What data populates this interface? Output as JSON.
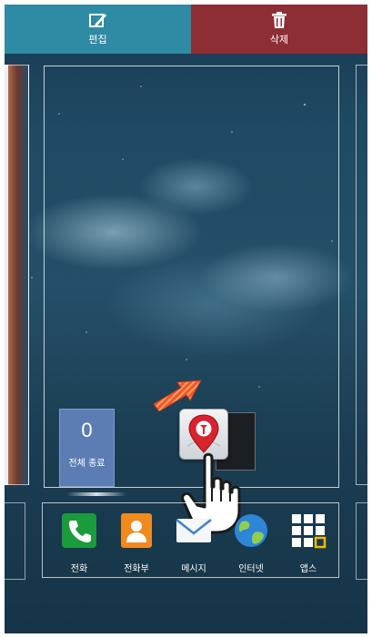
{
  "top_bar": {
    "edit_label": "편집",
    "delete_label": "삭제",
    "edit_color": "#2f8aa3",
    "delete_color": "#8d2d34",
    "edit_icon": "edit-icon",
    "delete_icon": "trash-icon"
  },
  "widget": {
    "count": "0",
    "label": "전체 종료",
    "color": "#5b7db3"
  },
  "dragged_app": {
    "icon": "map-pin-app-icon"
  },
  "dock": {
    "items": [
      {
        "label": "전화",
        "icon": "phone-icon",
        "color": "#1a9b3c"
      },
      {
        "label": "전화부",
        "icon": "contacts-icon",
        "color": "#f08a1c"
      },
      {
        "label": "메시지",
        "icon": "message-icon",
        "color": "#ffffff"
      },
      {
        "label": "인터넷",
        "icon": "internet-globe-icon",
        "color": "#2e86d6"
      },
      {
        "label": "앱스",
        "icon": "apps-grid-icon",
        "color": "#ffffff"
      }
    ]
  }
}
